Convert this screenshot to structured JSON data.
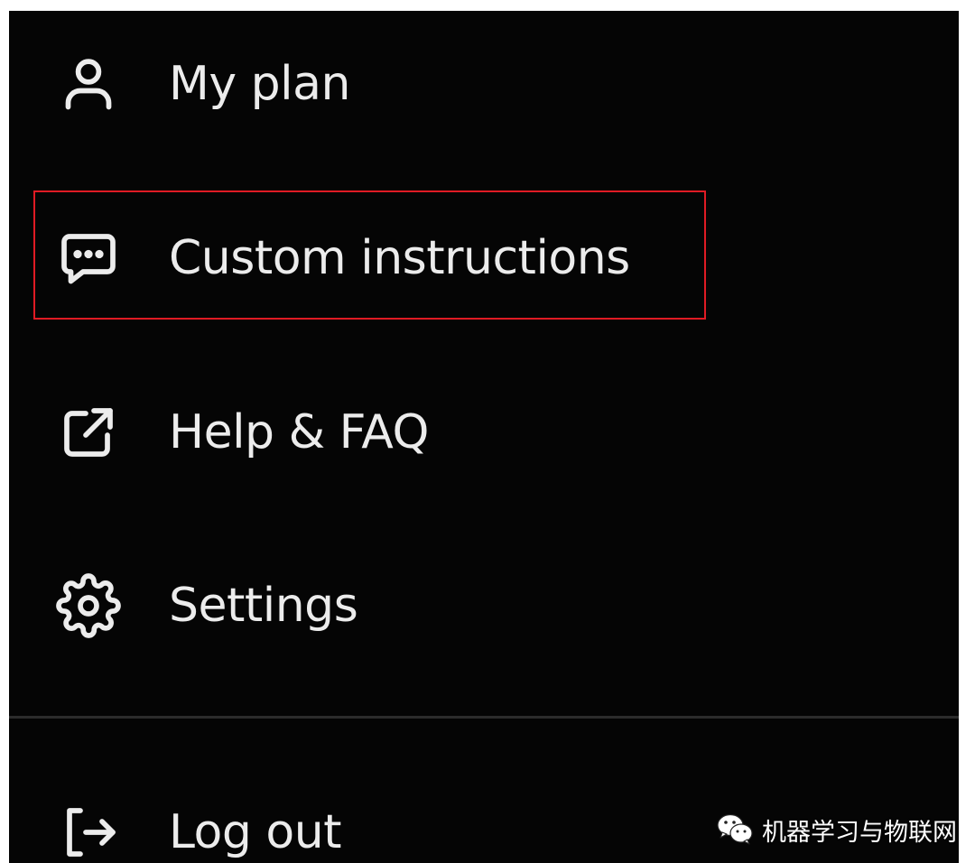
{
  "menu": {
    "items": [
      {
        "label": "My plan",
        "icon": "user-icon"
      },
      {
        "label": "Custom instructions",
        "icon": "chat-bubble-icon",
        "highlighted": true
      },
      {
        "label": "Help & FAQ",
        "icon": "external-link-icon"
      },
      {
        "label": "Settings",
        "icon": "gear-icon"
      },
      {
        "label": "Log out",
        "icon": "logout-icon"
      }
    ]
  },
  "colors": {
    "background": "#050505",
    "text": "#ececec",
    "highlight_border": "#e01b24",
    "divider": "#2c2c2c"
  },
  "watermark": {
    "text": "机器学习与物联网",
    "icon": "wechat-icon"
  }
}
